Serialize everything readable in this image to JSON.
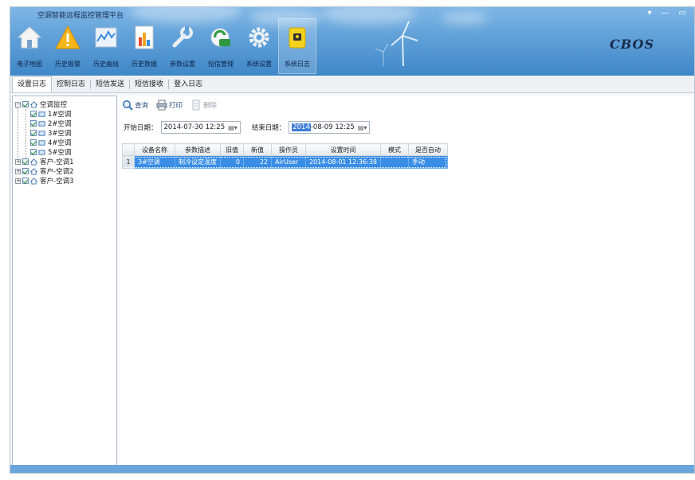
{
  "app": {
    "title": "空调智能远程监控管理平台",
    "brand": "CBOS",
    "window_controls": [
      "▾",
      "—",
      "▭"
    ]
  },
  "ribbon": [
    {
      "id": "map",
      "label": "电子地图",
      "icon": "home-icon"
    },
    {
      "id": "alarm",
      "label": "历史报警",
      "icon": "warning-icon"
    },
    {
      "id": "curve",
      "label": "历史曲线",
      "icon": "chart-icon"
    },
    {
      "id": "data",
      "label": "历史数据",
      "icon": "bar-chart-icon"
    },
    {
      "id": "params",
      "label": "参数设置",
      "icon": "wrench-icon"
    },
    {
      "id": "sms",
      "label": "短信管理",
      "icon": "message-icon"
    },
    {
      "id": "system",
      "label": "系统设置",
      "icon": "gear-icon"
    },
    {
      "id": "log",
      "label": "系统日志",
      "icon": "lock-icon",
      "active": true
    }
  ],
  "tabs": [
    {
      "label": "设置日志",
      "active": true
    },
    {
      "label": "控制日志"
    },
    {
      "label": "短信发送"
    },
    {
      "label": "短信接收"
    },
    {
      "label": "登入日志"
    }
  ],
  "tree": {
    "root": "空调监控",
    "children": [
      "1#空调",
      "2#空调",
      "3#空调",
      "4#空调",
      "5#空调"
    ],
    "others": [
      "客户-空调1",
      "客户-空调2",
      "客户-空调3"
    ]
  },
  "toolbar": {
    "query": "查询",
    "print": "打印",
    "delete": "删除"
  },
  "filter": {
    "start_label": "开始日期：",
    "start_value": "2014-07-30 12:25",
    "end_label": "结束日期：",
    "end_value_selected": "2014",
    "end_value_rest": "-08-09 12:25"
  },
  "grid": {
    "columns": [
      "设备名称",
      "参数描述",
      "旧值",
      "新值",
      "操作员",
      "设置时间",
      "模式",
      "是否自动"
    ],
    "rows": [
      {
        "no": "1",
        "cells": [
          "3#空调",
          "制冷设定温度",
          "0",
          "22",
          "AirUser",
          "2014-08-01 12:36:38",
          "",
          "手动"
        ]
      }
    ]
  }
}
